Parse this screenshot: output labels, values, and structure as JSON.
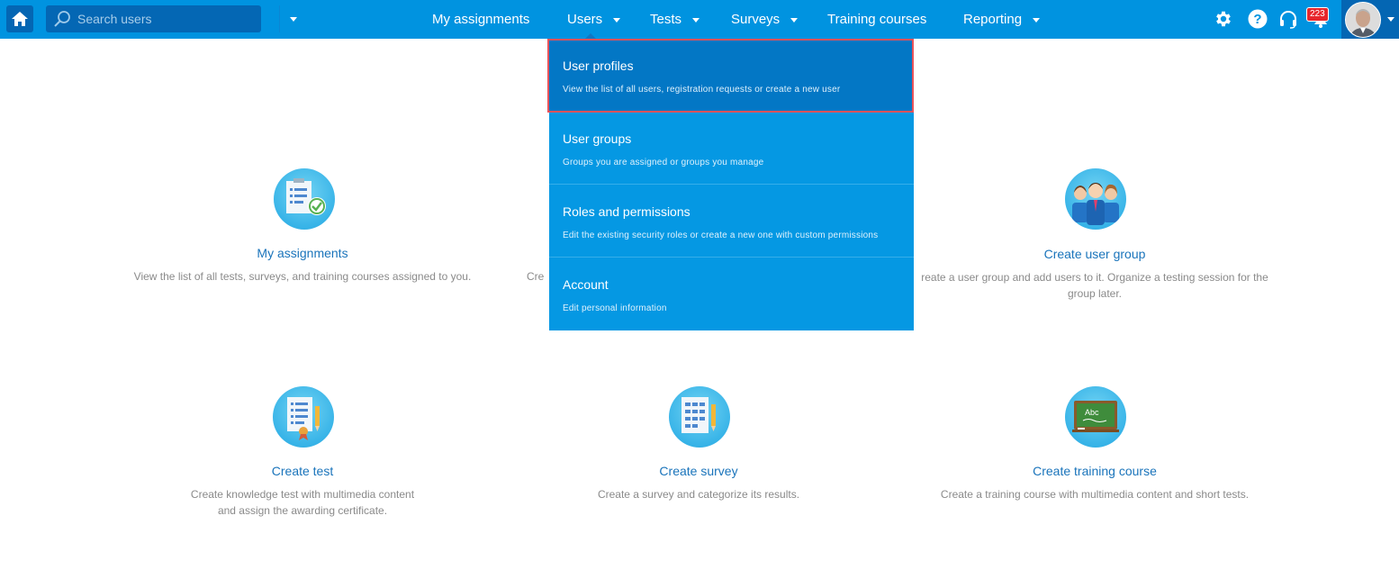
{
  "search": {
    "placeholder": "Search users"
  },
  "nav": {
    "my_assignments": "My assignments",
    "users": "Users",
    "tests": "Tests",
    "surveys": "Surveys",
    "training_courses": "Training courses",
    "reporting": "Reporting"
  },
  "notifications": {
    "count": "223"
  },
  "users_menu": {
    "items": [
      {
        "title": "User profiles",
        "desc": "View the list of all users, registration requests or create a new user"
      },
      {
        "title": "User groups",
        "desc": "Groups you are assigned or groups you manage"
      },
      {
        "title": "Roles and permissions",
        "desc": "Edit the existing security roles or create a new one with custom permissions"
      },
      {
        "title": "Account",
        "desc": "Edit personal information"
      }
    ]
  },
  "cards": {
    "my_assignments": {
      "title": "My assignments",
      "desc": "View the list of all tests, surveys, and training courses assigned to you."
    },
    "partial": {
      "desc": "Cre"
    },
    "create_user_group": {
      "title": "Create user group",
      "desc_line1": "reate a user group and add users to it. Organize a testing session for the",
      "desc_line2": "group later."
    },
    "create_test": {
      "title": "Create test",
      "desc_line1": "Create knowledge test with multimedia content",
      "desc_line2": "and assign the awarding certificate."
    },
    "create_survey": {
      "title": "Create survey",
      "desc": "Create a survey and categorize its results."
    },
    "create_training_course": {
      "title": "Create training course",
      "desc": "Create a training course with multimedia content and short tests."
    },
    "chalkboard_text": "Abc"
  },
  "colors": {
    "topbar": "#0093e0",
    "dropdown": "#0598e3",
    "active": "#0377c5",
    "highlight_border": "#e8535b",
    "link": "#1a74bb"
  }
}
